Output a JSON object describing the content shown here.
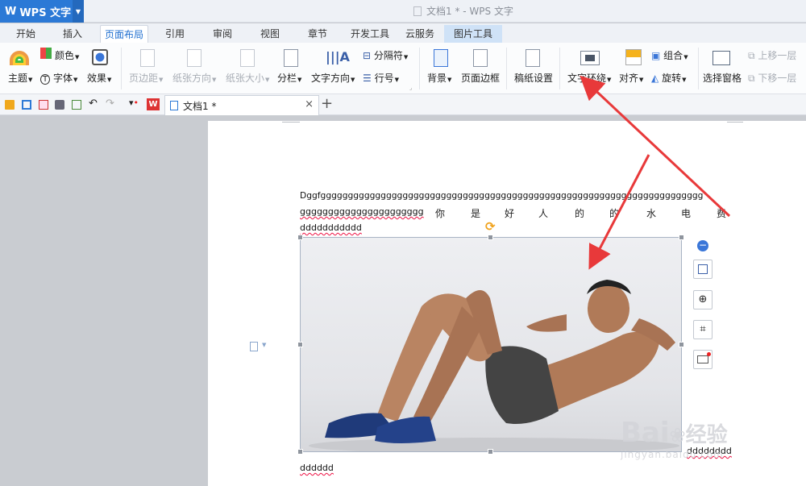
{
  "app": {
    "name": "WPS 文字",
    "window_title": "文档1 * - WPS 文字"
  },
  "tabs": [
    {
      "label": "开始"
    },
    {
      "label": "插入"
    },
    {
      "label": "页面布局"
    },
    {
      "label": "引用"
    },
    {
      "label": "审阅"
    },
    {
      "label": "视图"
    },
    {
      "label": "章节"
    },
    {
      "label": "开发工具"
    },
    {
      "label": "云服务"
    },
    {
      "label": "图片工具"
    }
  ],
  "ribbon": {
    "theme": "主题",
    "color": "颜色",
    "font": "字体",
    "effect": "效果",
    "margins": "页边距",
    "orientation": "纸张方向",
    "size": "纸张大小",
    "columns": "分栏",
    "text_direction": "文字方向",
    "separator": "分隔符",
    "line_number": "行号",
    "background": "背景",
    "page_border": "页面边框",
    "manuscript": "稿纸设置",
    "text_wrap": "文字环绕",
    "align": "对齐",
    "group": "组合",
    "rotate": "旋转",
    "selection_pane": "选择窗格",
    "bring_forward": "上移一层",
    "send_backward": "下移一层"
  },
  "doc_tab": {
    "title": "文档1 *"
  },
  "document": {
    "line1": "Dggfgggggggggggggggggggggggggggggggggggggggggggggggggggggggggggggggggggggg",
    "line2_latin": "gggggggggggggggggggggg",
    "line2_cjk": [
      "你",
      "是",
      "好",
      "人",
      "的",
      "的",
      "水",
      "电",
      "费"
    ],
    "line3": "ddddddddddd",
    "caption_right": "dddddddd",
    "caption_below": "dddddd"
  },
  "watermark": {
    "brand": "Bai",
    "brand_cn": "经验",
    "url": "jingyan.baidu.com"
  },
  "colors": {
    "accent": "#2b79d6",
    "arrow": "#e8393a"
  }
}
